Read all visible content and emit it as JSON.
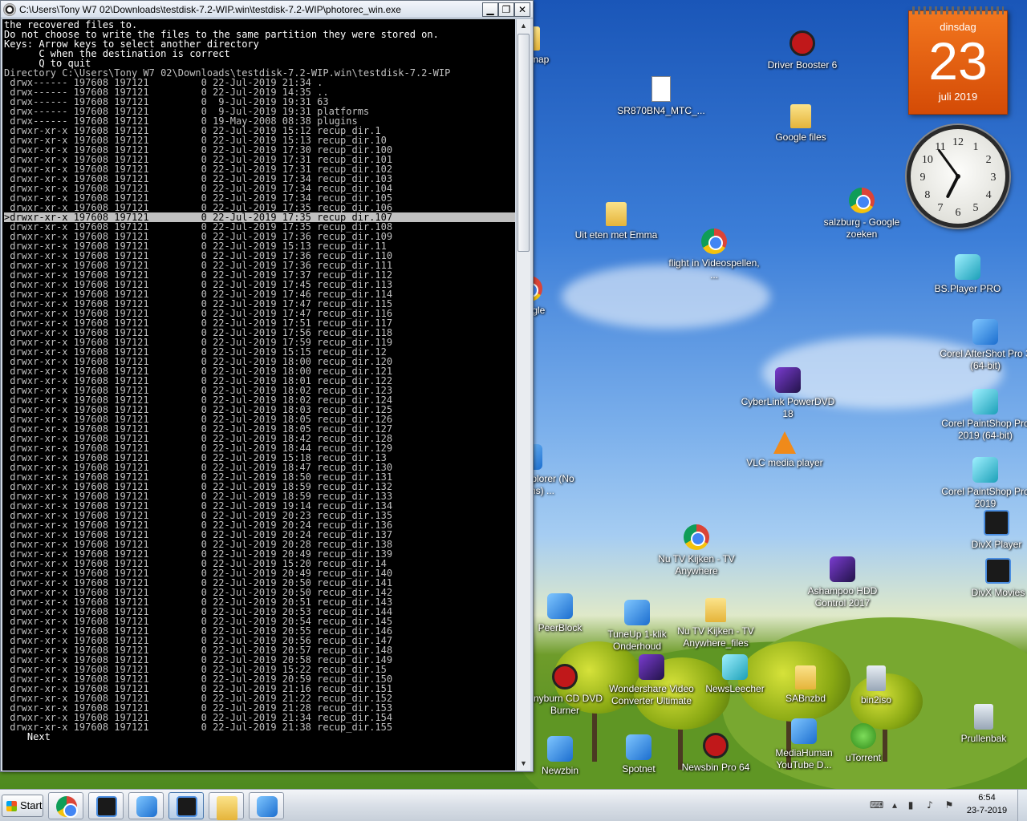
{
  "window": {
    "title": "C:\\Users\\Tony W7 02\\Downloads\\testdisk-7.2-WIP.win\\testdisk-7.2-WIP\\photorec_win.exe",
    "btn_min": "▁",
    "btn_max": "❐",
    "btn_close": "✕"
  },
  "console": {
    "header": [
      "the recovered files to.",
      "Do not choose to write the files to the same partition they were stored on.",
      "Keys: Arrow keys to select another directory",
      "      C when the destination is correct",
      "      Q to quit",
      "Directory C:\\Users\\Tony W7 02\\Downloads\\testdisk-7.2-WIP.win\\testdisk-7.2-WIP"
    ],
    "rows": [
      " drwx------ 197608 197121         0 22-Jul-2019 21:34 .",
      " drwx------ 197608 197121         0 22-Jul-2019 14:35 ..",
      " drwx------ 197608 197121         0  9-Jul-2019 19:31 63",
      " drwx------ 197608 197121         0  9-Jul-2019 19:31 platforms",
      " drwx------ 197608 197121         0 19-May-2008 08:38 plugins",
      " drwxr-xr-x 197608 197121         0 22-Jul-2019 15:12 recup_dir.1",
      " drwxr-xr-x 197608 197121         0 22-Jul-2019 15:13 recup_dir.10",
      " drwxr-xr-x 197608 197121         0 22-Jul-2019 17:30 recup_dir.100",
      " drwxr-xr-x 197608 197121         0 22-Jul-2019 17:31 recup_dir.101",
      " drwxr-xr-x 197608 197121         0 22-Jul-2019 17:31 recup_dir.102",
      " drwxr-xr-x 197608 197121         0 22-Jul-2019 17:34 recup_dir.103",
      " drwxr-xr-x 197608 197121         0 22-Jul-2019 17:34 recup_dir.104",
      " drwxr-xr-x 197608 197121         0 22-Jul-2019 17:34 recup_dir.105",
      " drwxr-xr-x 197608 197121         0 22-Jul-2019 17:35 recup_dir.106",
      ">drwxr-xr-x 197608 197121         0 22-Jul-2019 17:35 recup_dir.107",
      " drwxr-xr-x 197608 197121         0 22-Jul-2019 17:35 recup_dir.108",
      " drwxr-xr-x 197608 197121         0 22-Jul-2019 17:36 recup_dir.109",
      " drwxr-xr-x 197608 197121         0 22-Jul-2019 15:13 recup_dir.11",
      " drwxr-xr-x 197608 197121         0 22-Jul-2019 17:36 recup_dir.110",
      " drwxr-xr-x 197608 197121         0 22-Jul-2019 17:36 recup_dir.111",
      " drwxr-xr-x 197608 197121         0 22-Jul-2019 17:37 recup_dir.112",
      " drwxr-xr-x 197608 197121         0 22-Jul-2019 17:45 recup_dir.113",
      " drwxr-xr-x 197608 197121         0 22-Jul-2019 17:46 recup_dir.114",
      " drwxr-xr-x 197608 197121         0 22-Jul-2019 17:47 recup_dir.115",
      " drwxr-xr-x 197608 197121         0 22-Jul-2019 17:47 recup_dir.116",
      " drwxr-xr-x 197608 197121         0 22-Jul-2019 17:51 recup_dir.117",
      " drwxr-xr-x 197608 197121         0 22-Jul-2019 17:56 recup_dir.118",
      " drwxr-xr-x 197608 197121         0 22-Jul-2019 17:59 recup_dir.119",
      " drwxr-xr-x 197608 197121         0 22-Jul-2019 15:15 recup_dir.12",
      " drwxr-xr-x 197608 197121         0 22-Jul-2019 18:00 recup_dir.120",
      " drwxr-xr-x 197608 197121         0 22-Jul-2019 18:00 recup_dir.121",
      " drwxr-xr-x 197608 197121         0 22-Jul-2019 18:01 recup_dir.122",
      " drwxr-xr-x 197608 197121         0 22-Jul-2019 18:02 recup_dir.123",
      " drwxr-xr-x 197608 197121         0 22-Jul-2019 18:02 recup_dir.124",
      " drwxr-xr-x 197608 197121         0 22-Jul-2019 18:03 recup_dir.125",
      " drwxr-xr-x 197608 197121         0 22-Jul-2019 18:05 recup_dir.126",
      " drwxr-xr-x 197608 197121         0 22-Jul-2019 18:05 recup_dir.127",
      " drwxr-xr-x 197608 197121         0 22-Jul-2019 18:42 recup_dir.128",
      " drwxr-xr-x 197608 197121         0 22-Jul-2019 18:44 recup_dir.129",
      " drwxr-xr-x 197608 197121         0 22-Jul-2019 15:18 recup_dir.13",
      " drwxr-xr-x 197608 197121         0 22-Jul-2019 18:47 recup_dir.130",
      " drwxr-xr-x 197608 197121         0 22-Jul-2019 18:50 recup_dir.131",
      " drwxr-xr-x 197608 197121         0 22-Jul-2019 18:59 recup_dir.132",
      " drwxr-xr-x 197608 197121         0 22-Jul-2019 18:59 recup_dir.133",
      " drwxr-xr-x 197608 197121         0 22-Jul-2019 19:14 recup_dir.134",
      " drwxr-xr-x 197608 197121         0 22-Jul-2019 20:23 recup_dir.135",
      " drwxr-xr-x 197608 197121         0 22-Jul-2019 20:24 recup_dir.136",
      " drwxr-xr-x 197608 197121         0 22-Jul-2019 20:24 recup_dir.137",
      " drwxr-xr-x 197608 197121         0 22-Jul-2019 20:28 recup_dir.138",
      " drwxr-xr-x 197608 197121         0 22-Jul-2019 20:49 recup_dir.139",
      " drwxr-xr-x 197608 197121         0 22-Jul-2019 15:20 recup_dir.14",
      " drwxr-xr-x 197608 197121         0 22-Jul-2019 20:49 recup_dir.140",
      " drwxr-xr-x 197608 197121         0 22-Jul-2019 20:50 recup_dir.141",
      " drwxr-xr-x 197608 197121         0 22-Jul-2019 20:50 recup_dir.142",
      " drwxr-xr-x 197608 197121         0 22-Jul-2019 20:51 recup_dir.143",
      " drwxr-xr-x 197608 197121         0 22-Jul-2019 20:53 recup_dir.144",
      " drwxr-xr-x 197608 197121         0 22-Jul-2019 20:54 recup_dir.145",
      " drwxr-xr-x 197608 197121         0 22-Jul-2019 20:55 recup_dir.146",
      " drwxr-xr-x 197608 197121         0 22-Jul-2019 20:56 recup_dir.147",
      " drwxr-xr-x 197608 197121         0 22-Jul-2019 20:57 recup_dir.148",
      " drwxr-xr-x 197608 197121         0 22-Jul-2019 20:58 recup_dir.149",
      " drwxr-xr-x 197608 197121         0 22-Jul-2019 15:22 recup_dir.15",
      " drwxr-xr-x 197608 197121         0 22-Jul-2019 20:59 recup_dir.150",
      " drwxr-xr-x 197608 197121         0 22-Jul-2019 21:16 recup_dir.151",
      " drwxr-xr-x 197608 197121         0 22-Jul-2019 21:22 recup_dir.152",
      " drwxr-xr-x 197608 197121         0 22-Jul-2019 21:28 recup_dir.153",
      " drwxr-xr-x 197608 197121         0 22-Jul-2019 21:34 recup_dir.154",
      " drwxr-xr-x 197608 197121         0 22-Jul-2019 21:38 recup_dir.155"
    ],
    "selected_index": 14,
    "footer": "    Next"
  },
  "desktop_icons": [
    {
      "name": "driver-booster-icon",
      "label": "Driver Booster 6",
      "glyph": "red"
    },
    {
      "name": "document-file-icon",
      "label": "SR870BN4_MTC_...",
      "glyph": "doc"
    },
    {
      "name": "folder-icon",
      "label": "Google files",
      "glyph": "folder"
    },
    {
      "name": "chrome-icon",
      "label": "salzburg - Google zoeken",
      "glyph": "chrome"
    },
    {
      "name": "folder-icon",
      "label": "Uit eten met Emma",
      "glyph": "folder"
    },
    {
      "name": "chrome-icon",
      "label": "flight in Videospellen, ...",
      "glyph": "chrome"
    },
    {
      "name": "bsplayer-icon",
      "label": "BS.Player PRO",
      "glyph": "cyan"
    },
    {
      "name": "aftershot-icon",
      "label": "Corel AfterShot Pro 3 (64-bit)",
      "glyph": "blue"
    },
    {
      "name": "powerdvd-icon",
      "label": "CyberLink PowerDVD 18",
      "glyph": "purple"
    },
    {
      "name": "paintshop-icon",
      "label": "Corel PaintShop Pro 2019 (64-bit)",
      "glyph": "cyan"
    },
    {
      "name": "vlc-icon",
      "label": "VLC media player",
      "glyph": "vlc"
    },
    {
      "name": "paintshop-icon",
      "label": "Corel PaintShop Pro 2019",
      "glyph": "cyan"
    },
    {
      "name": "divx-player-icon",
      "label": "DivX Player",
      "glyph": "dark"
    },
    {
      "name": "chrome-icon",
      "label": "Nu TV Kijken - TV Anywhere",
      "glyph": "chrome"
    },
    {
      "name": "ashampoo-icon",
      "label": "Ashampoo HDD Control 2017",
      "glyph": "purple"
    },
    {
      "name": "divx-movies-icon",
      "label": "DivX Movies",
      "glyph": "dark"
    },
    {
      "name": "peerblock-icon",
      "label": "PeerBlock",
      "glyph": "blue"
    },
    {
      "name": "tuneup-icon",
      "label": "TuneUp 1-klik Onderhoud",
      "glyph": "blue"
    },
    {
      "name": "folder-icon",
      "label": "Nu TV Kijken - TV Anywhere_files",
      "glyph": "folder"
    },
    {
      "name": "cd-dvd-burner-icon",
      "label": "Anyburn CD DVD Burner",
      "glyph": "red"
    },
    {
      "name": "video-converter-icon",
      "label": "Wondershare Video Converter Ultimate",
      "glyph": "purple"
    },
    {
      "name": "newsleecher-icon",
      "label": "NewsLeecher",
      "glyph": "cyan"
    },
    {
      "name": "sabnzbd-icon",
      "label": "SABnzbd",
      "glyph": "folder"
    },
    {
      "name": "bin2iso-icon",
      "label": "bin2iso",
      "glyph": "bin"
    },
    {
      "name": "recycle-bin-icon",
      "label": "Prullenbak",
      "glyph": "bin"
    },
    {
      "name": "newzbin-icon",
      "label": "Newzbin",
      "glyph": "blue"
    },
    {
      "name": "spotnet-icon",
      "label": "Spotnet",
      "glyph": "blue"
    },
    {
      "name": "newsbin-icon",
      "label": "Newsbin Pro 64",
      "glyph": "red"
    },
    {
      "name": "mediahuman-icon",
      "label": "MediaHuman YouTube D...",
      "glyph": "blue"
    },
    {
      "name": "utorrent-icon",
      "label": "uTorrent",
      "glyph": "green"
    },
    {
      "name": "folder-icon",
      "label": "Live map",
      "glyph": "folder"
    },
    {
      "name": "google-icon",
      "label": "Google",
      "glyph": "chrome"
    },
    {
      "name": "internet-explorer-icon",
      "label": "Internet Explorer (No Add-ons) ...",
      "glyph": "blue"
    }
  ],
  "calendar": {
    "weekday": "dinsdag",
    "day": "23",
    "month": "juli 2019"
  },
  "clock": {
    "hour": 6,
    "minute": 54
  },
  "taskbar": {
    "start_label": "Start",
    "buttons": [
      {
        "name": "chrome-taskbar-button",
        "glyph": "chrome"
      },
      {
        "name": "system-monitor-taskbar-button",
        "glyph": "dark"
      },
      {
        "name": "outlook-taskbar-button",
        "glyph": "blue"
      },
      {
        "name": "photorec-taskbar-button",
        "glyph": "dark",
        "active": true
      },
      {
        "name": "explorer-taskbar-button",
        "glyph": "folder"
      },
      {
        "name": "network-taskbar-button",
        "glyph": "blue"
      }
    ],
    "time": "6:54",
    "date": "23-7-2019"
  }
}
